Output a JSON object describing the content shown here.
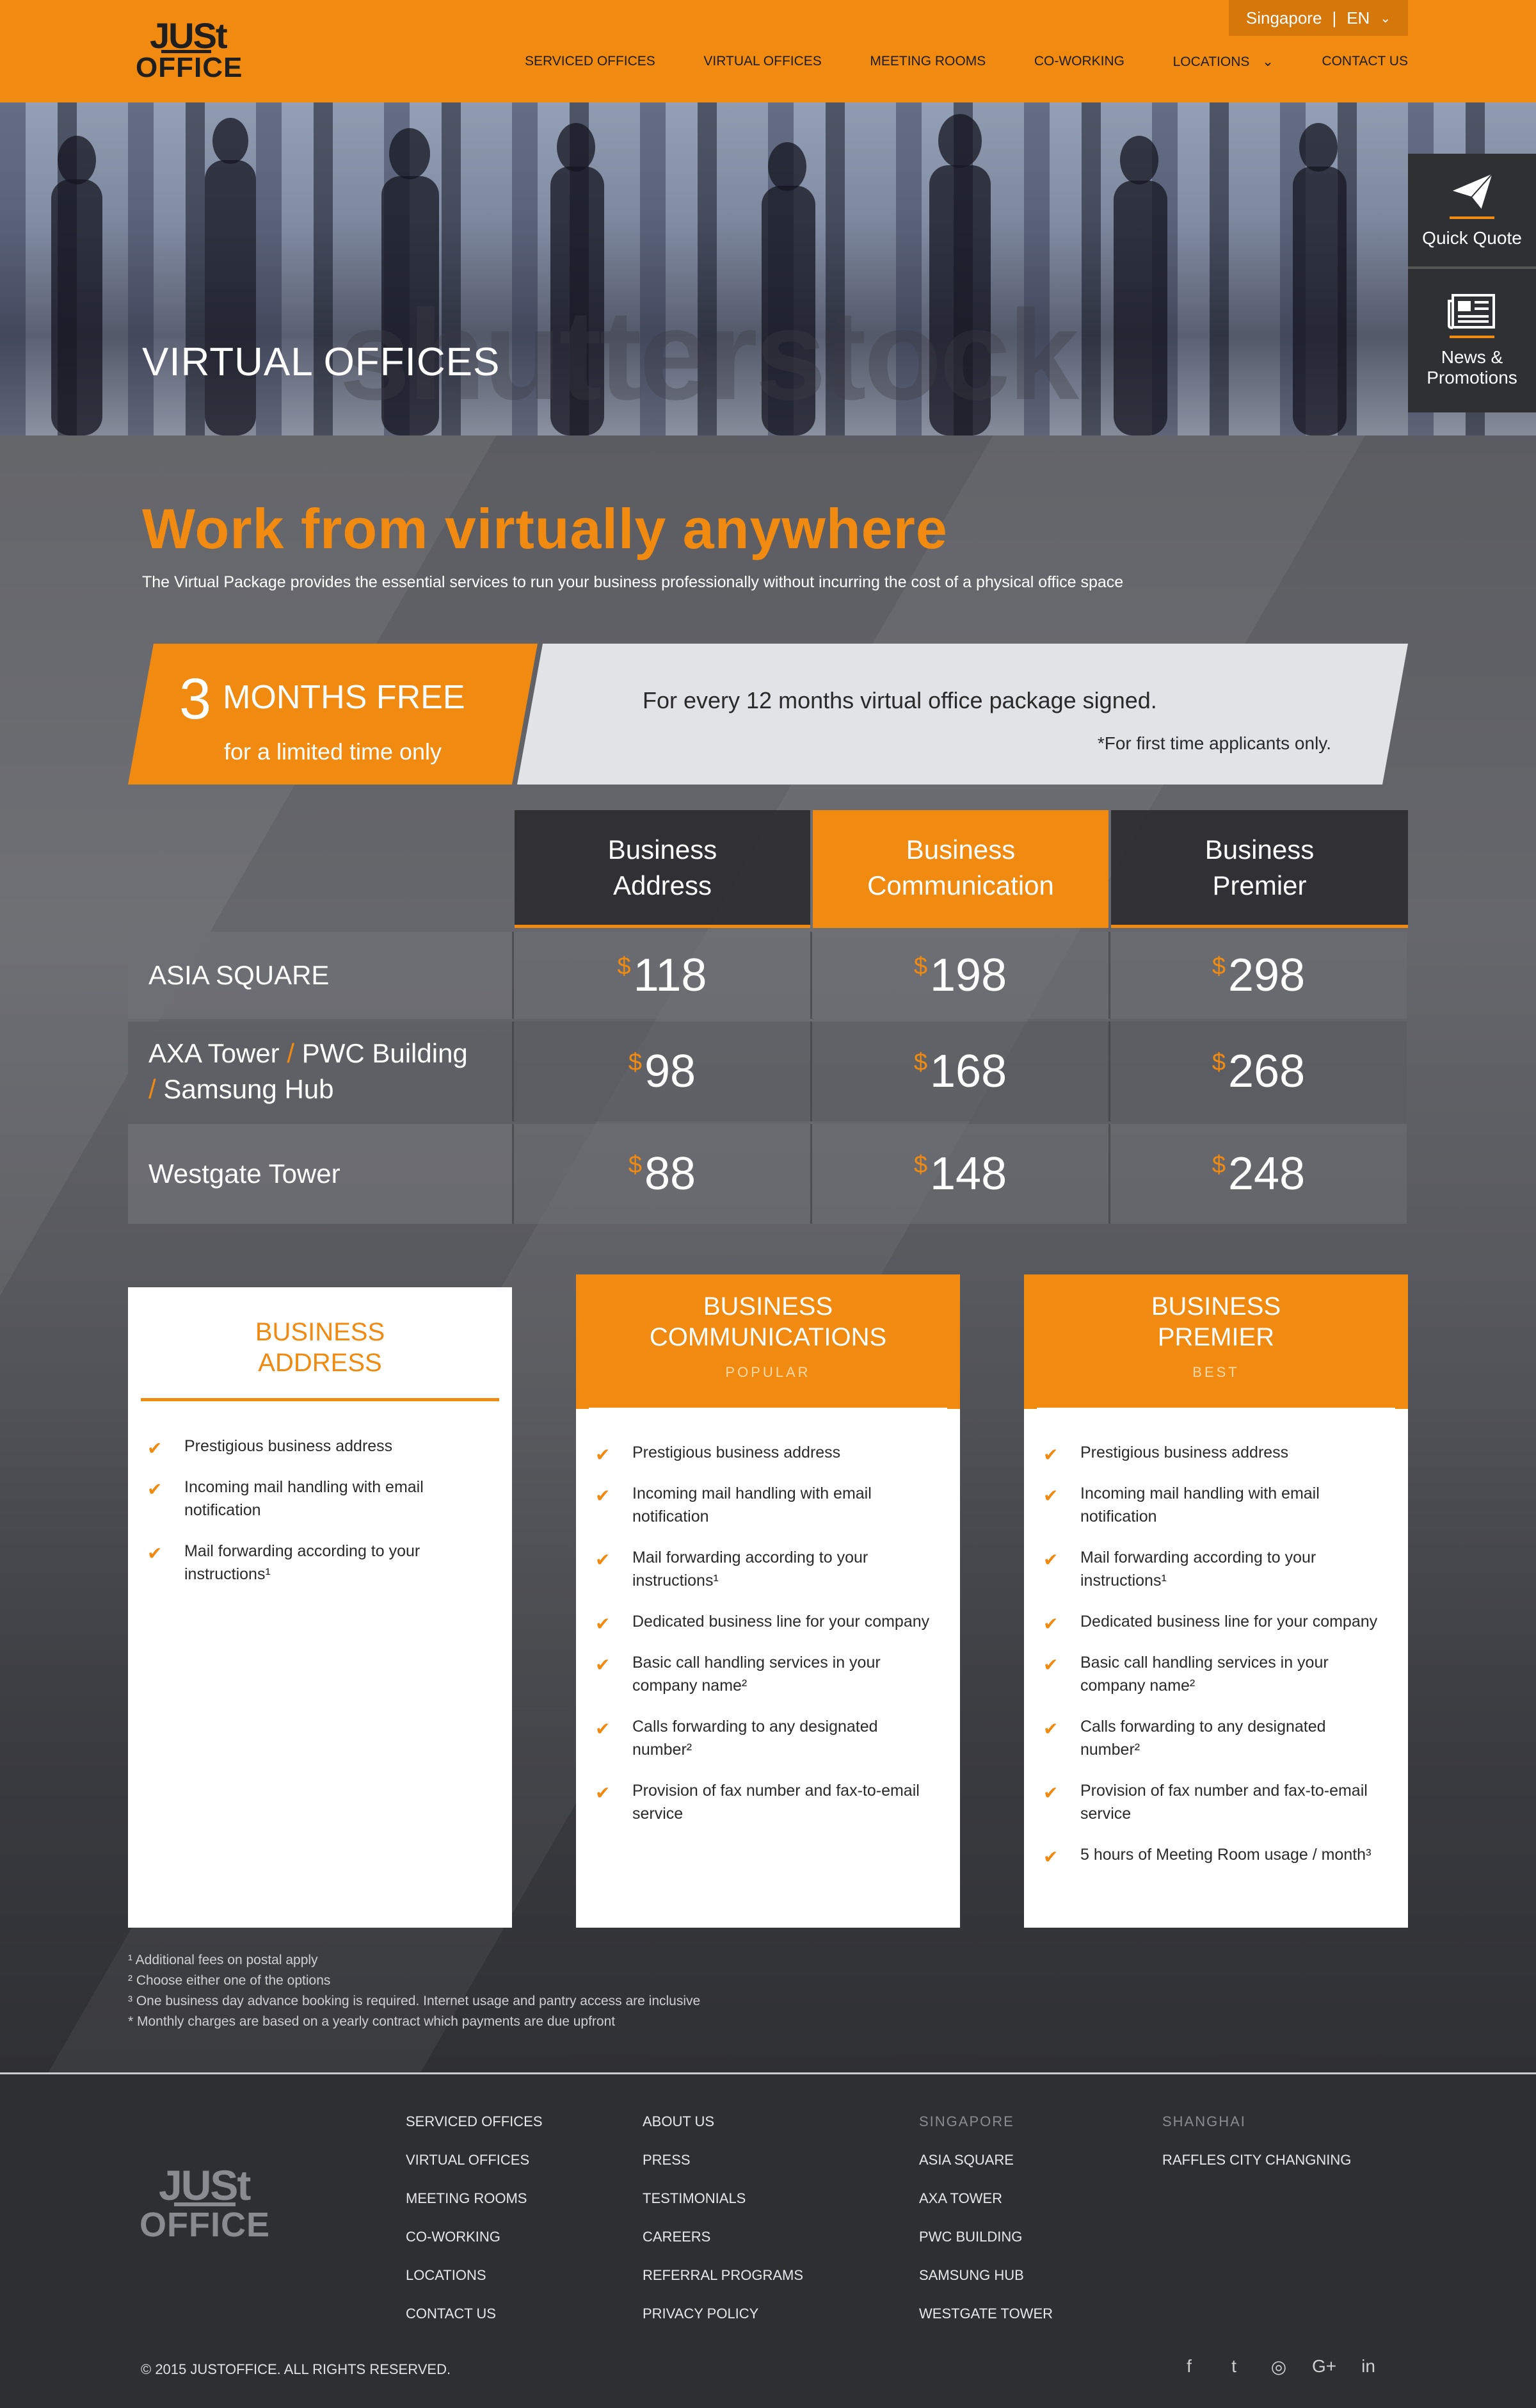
{
  "header": {
    "logo_top": "JUSt",
    "logo_bottom": "OFFICE",
    "region": "Singapore",
    "separator": "|",
    "language": "EN",
    "nav": [
      "SERVICED OFFICES",
      "VIRTUAL OFFICES",
      "MEETING ROOMS",
      "CO-WORKING",
      "LOCATIONS",
      "CONTACT US"
    ]
  },
  "hero": {
    "title": "VIRTUAL OFFICES",
    "watermark": "shutterstock"
  },
  "side": {
    "quote": "Quick Quote",
    "news_line1": "News &",
    "news_line2": "Promotions"
  },
  "intro": {
    "headline": "Work from virtually anywhere",
    "description": "The Virtual Package provides the essential services to run your business professionally without incurring the cost of a physical office space"
  },
  "promo": {
    "number": "3",
    "offer": "MONTHS FREE",
    "sub": "for a limited time only",
    "detail": "For every 12 months virtual office package signed.",
    "note": "*For first time applicants only."
  },
  "pricing": {
    "headers": [
      {
        "line1": "Business",
        "line2": "Address"
      },
      {
        "line1": "Business",
        "line2": "Communication"
      },
      {
        "line1": "Business",
        "line2": "Premier"
      }
    ],
    "currency": "$",
    "rows": [
      {
        "location": "ASIA SQUARE",
        "prices": [
          "118",
          "198",
          "298"
        ]
      },
      {
        "location_parts": [
          "AXA Tower",
          "PWC Building",
          "Samsung Hub"
        ],
        "slash": "/",
        "prices": [
          "98",
          "168",
          "268"
        ]
      },
      {
        "location": "Westgate Tower",
        "prices": [
          "88",
          "148",
          "248"
        ]
      }
    ]
  },
  "plans": [
    {
      "title_line1": "BUSINESS",
      "title_line2": "ADDRESS",
      "features": [
        "Prestigious business address",
        "Incoming mail handling with email notification",
        "Mail forwarding according to your instructions¹"
      ]
    },
    {
      "title_line1": "BUSINESS",
      "title_line2": "COMMUNICATIONS",
      "tag": "POPULAR",
      "features": [
        "Prestigious business address",
        "Incoming mail handling with email notification",
        "Mail forwarding according to your instructions¹",
        "Dedicated business line for your company",
        "Basic call handling services in your company name²",
        "Calls forwarding to any designated number²",
        "Provision of fax number and fax-to-email service"
      ]
    },
    {
      "title_line1": "BUSINESS",
      "title_line2": "PREMIER",
      "tag": "BEST",
      "features": [
        "Prestigious business address",
        "Incoming mail handling with email notification",
        "Mail forwarding according to your instructions¹",
        "Dedicated business line for your company",
        "Basic call handling services in your company name²",
        "Calls forwarding to any designated number²",
        "Provision of fax number and fax-to-email service",
        "5 hours of Meeting Room usage / month³"
      ]
    }
  ],
  "footnotes": [
    "¹  Additional fees on postal apply",
    "²  Choose either one of the options",
    "³  One business day advance booking is required. Internet usage and pantry access are inclusive",
    "* Monthly charges are based on a yearly contract which payments are due upfront"
  ],
  "footer": {
    "col1": [
      "SERVICED OFFICES",
      "VIRTUAL OFFICES",
      "MEETING ROOMS",
      "CO-WORKING",
      "LOCATIONS",
      "CONTACT US"
    ],
    "col2": [
      "ABOUT US",
      "PRESS",
      "TESTIMONIALS",
      "CAREERS",
      "REFERRAL PROGRAMS",
      "PRIVACY POLICY"
    ],
    "singapore_head": "SINGAPORE",
    "singapore": [
      "ASIA SQUARE",
      "AXA TOWER",
      "PWC BUILDING",
      "SAMSUNG HUB",
      "WESTGATE TOWER"
    ],
    "shanghai_head": "SHANGHAI",
    "shanghai": [
      "RAFFLES CITY CHANGNING"
    ],
    "copyright": "© 2015 JUSTOFFICE. ALL RIGHTS RESERVED.",
    "social_icons": [
      "facebook-icon",
      "twitter-icon",
      "instagram-icon",
      "google-plus-icon",
      "linkedin-icon"
    ],
    "social_glyphs": [
      "f",
      "t",
      "◎",
      "G+",
      "in"
    ]
  },
  "colors": {
    "accent": "#f08a11",
    "dark": "#2e2f33"
  }
}
